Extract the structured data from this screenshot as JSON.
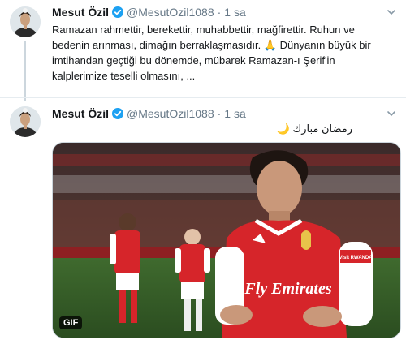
{
  "tweets": [
    {
      "display_name": "Mesut Özil",
      "handle": "@MesutOzil1088",
      "separator": "·",
      "time": "1 sa",
      "text": "Ramazan rahmettir, berekettir, muhabbettir, mağfirettir. Ruhun ve bedenin arınması, dimağın berraklaşmasıdır. 🙏 Dünyanın büyük bir imtihandan geçtiği bu dönemde, mübarek Ramazan-ı Şerif'in kalplerimize teselli olmasını, ..."
    },
    {
      "display_name": "Mesut Özil",
      "handle": "@MesutOzil1088",
      "separator": "·",
      "time": "1 sa",
      "text": "رمضان مبارك 🌙",
      "media": {
        "badge": "GIF",
        "shirt_sponsor": "Fly Emirates",
        "sleeve_text": "Visit RWANDA"
      }
    }
  ],
  "icons": {
    "verified": "verified-badge-icon",
    "more": "chevron-down-icon"
  },
  "colors": {
    "verified": "#1da1f2",
    "secondary_text": "#657786",
    "divider": "#e6ecf0",
    "arsenal_red": "#d6252a"
  }
}
